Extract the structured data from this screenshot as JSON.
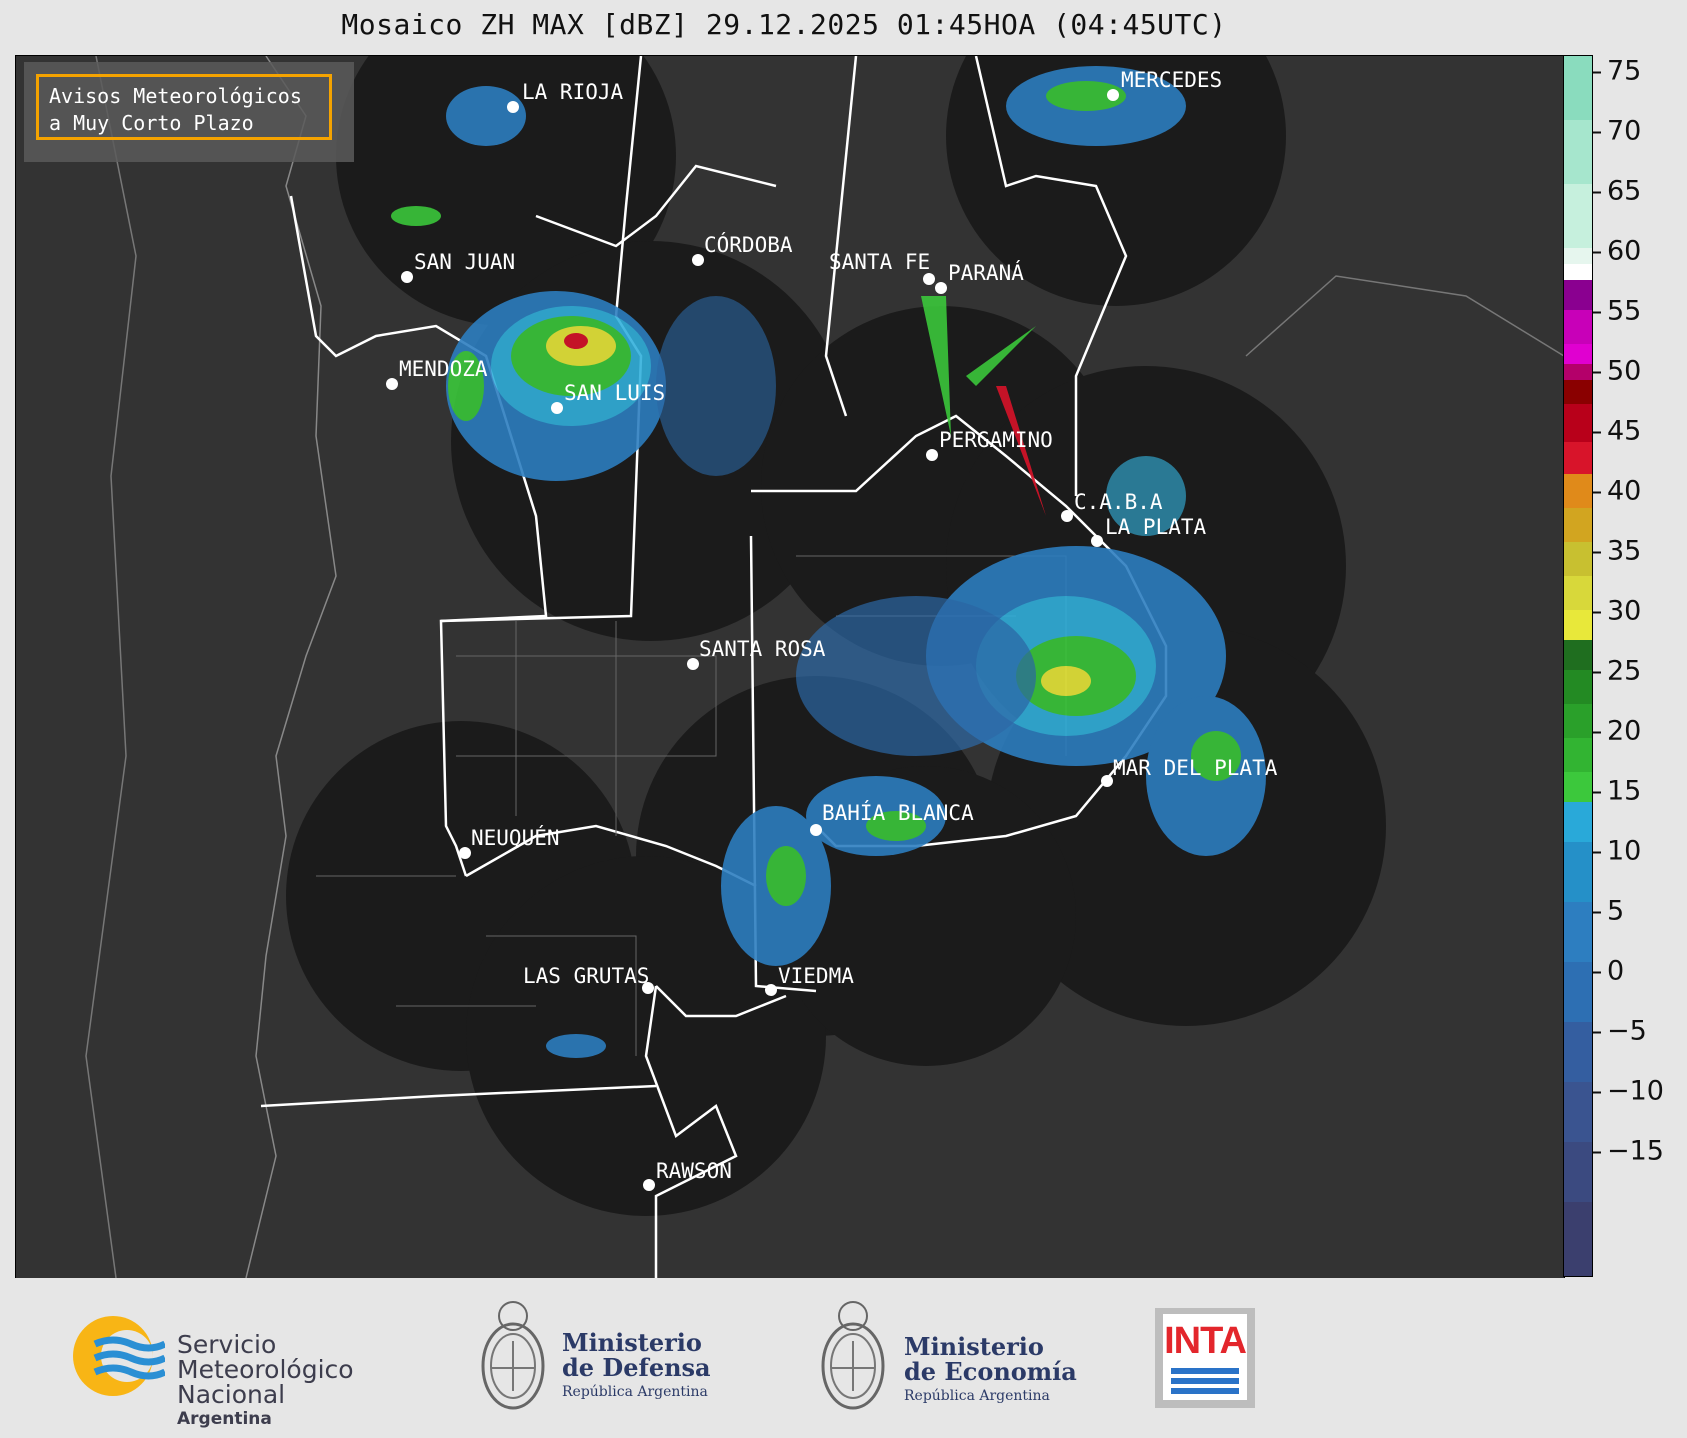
{
  "title": "Mosaico ZH MAX [dBZ] 29.12.2025 01:45HOA (04:45UTC)",
  "warning": {
    "line1": "Avisos Meteorológicos",
    "line2": "a Muy Corto Plazo",
    "border_color": "#f5a300"
  },
  "cities": [
    {
      "name": "LA RIOJA"
    },
    {
      "name": "MERCEDES"
    },
    {
      "name": "CÓRDOBA"
    },
    {
      "name": "SAN JUAN"
    },
    {
      "name": "SANTA FE"
    },
    {
      "name": "PARANÁ"
    },
    {
      "name": "MENDOZA"
    },
    {
      "name": "SAN LUIS"
    },
    {
      "name": "PERGAMINO"
    },
    {
      "name": "C.A.B.A"
    },
    {
      "name": "LA PLATA"
    },
    {
      "name": "SANTA ROSA"
    },
    {
      "name": "MAR DEL PLATA"
    },
    {
      "name": "BAHÍA BLANCA"
    },
    {
      "name": "NEUQUÉN"
    },
    {
      "name": "LAS GRUTAS"
    },
    {
      "name": "VIEDMA"
    },
    {
      "name": "RAWSON"
    }
  ],
  "colorbar": {
    "unit": "dBZ",
    "range": [
      -19,
      76
    ],
    "ticks": [
      "75",
      "70",
      "65",
      "60",
      "55",
      "50",
      "45",
      "40",
      "35",
      "30",
      "25",
      "20",
      "15",
      "10",
      "5",
      "0",
      "−5",
      "−10",
      "−15"
    ],
    "colors": {
      "low": "#3b3f6e",
      "blue": "#2d6fb3",
      "cyan": "#29a9d9",
      "green": "#3cc83c",
      "darkgreen": "#1f6e1f",
      "yellow": "#e8e83a",
      "orange": "#e08a1a",
      "red": "#d8142a",
      "darkred": "#8a0000",
      "magenta": "#e000d0",
      "purple": "#8a0090",
      "white": "#ffffff",
      "mint": "#8adcbe"
    }
  },
  "footer": {
    "smn": {
      "line1": "Servicio",
      "line2": "Meteorológico",
      "line3": "Nacional",
      "line4": "Argentina"
    },
    "defensa": {
      "line1": "Ministerio",
      "line2": "de Defensa",
      "line3": "República Argentina"
    },
    "economia": {
      "line1": "Ministerio",
      "line2": "de Economía",
      "line3": "República Argentina"
    },
    "inta": {
      "label": "INTA"
    }
  }
}
